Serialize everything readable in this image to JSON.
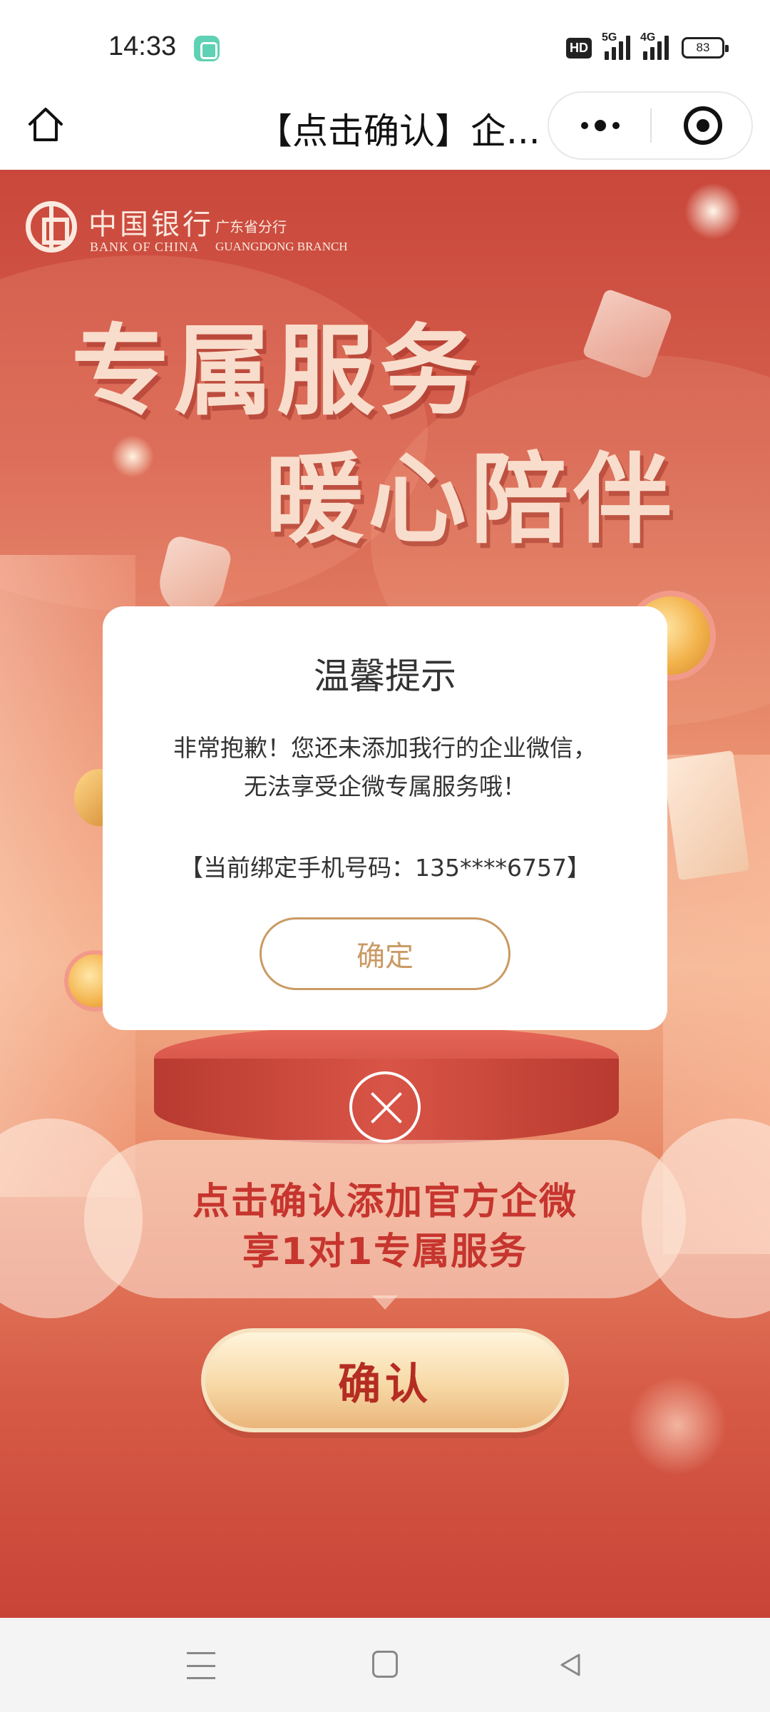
{
  "status_bar": {
    "time": "14:33",
    "hd": "HD",
    "signal1_tag": "5G",
    "signal2_tag": "4G",
    "battery": "83"
  },
  "nav_bar": {
    "title": "【点击确认】企...",
    "icons": [
      "home-icon",
      "more-icon",
      "close-miniprogram-icon"
    ]
  },
  "poster": {
    "bank_name_cn": "中国银行",
    "bank_name_en": "BANK OF CHINA",
    "branch_cn": "广东省分行",
    "branch_en": "GUANGDONG BRANCH",
    "headline_line1": "专属服务",
    "headline_line2": "暖心陪伴",
    "promo_line1": "点击确认添加官方企微",
    "promo_line2": "享1对1专属服务",
    "confirm_button": "确认"
  },
  "dialog": {
    "title": "温馨提示",
    "message_line1": "非常抱歉！您还未添加我行的企业微信，",
    "message_line2": "无法享受企微专属服务哦！",
    "phone_text": "【当前绑定手机号码：135****6757】",
    "ok_button": "确定"
  },
  "colors": {
    "primary_red": "#c6352e",
    "dialog_button": "#c99a63"
  }
}
